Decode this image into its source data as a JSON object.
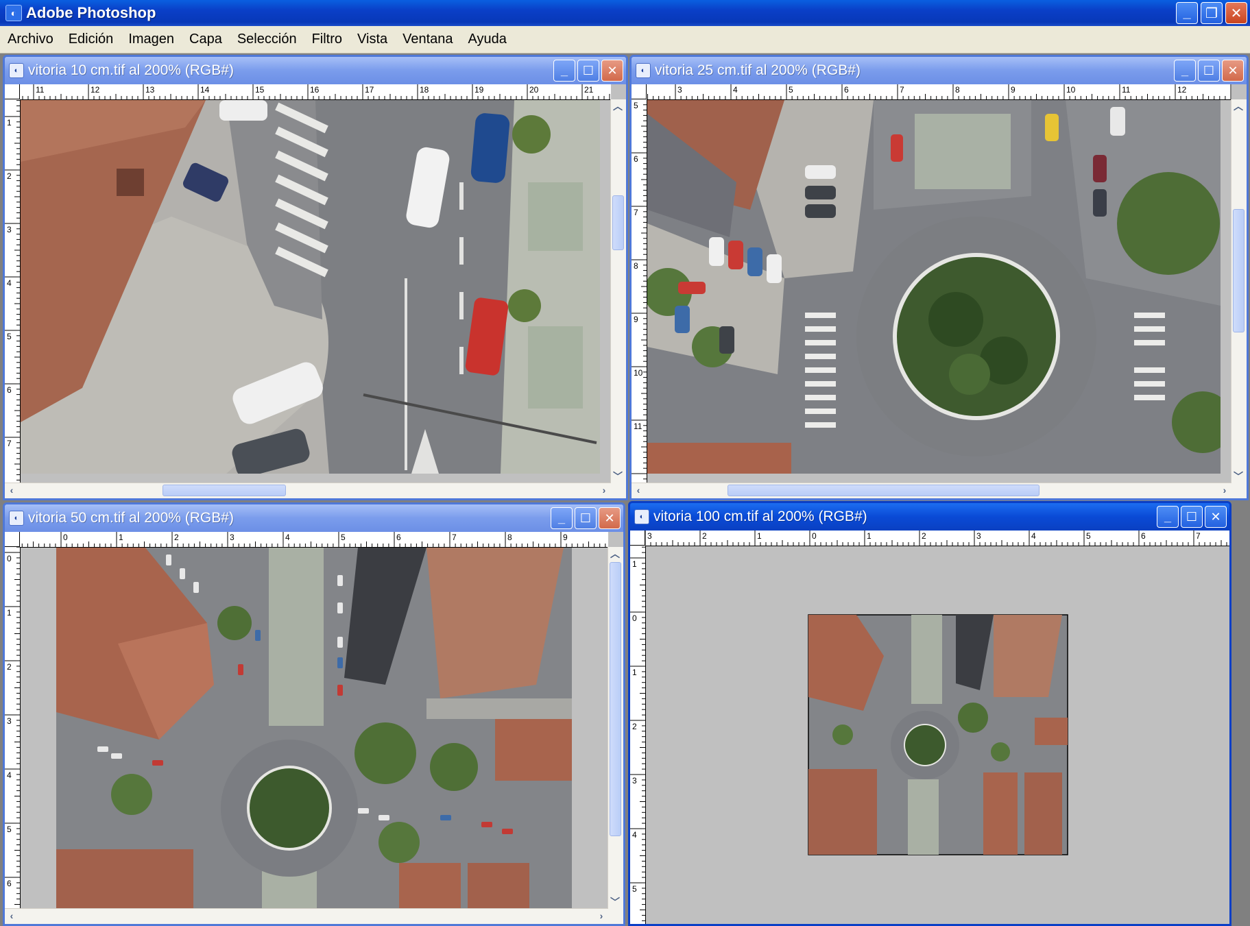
{
  "app": {
    "title": "Adobe Photoshop",
    "icon": "photoshop-app-icon",
    "controls": {
      "minimize": "_",
      "restore": "❐",
      "close": "✕"
    }
  },
  "menu": [
    "Archivo",
    "Edición",
    "Imagen",
    "Capa",
    "Selección",
    "Filtro",
    "Vista",
    "Ventana",
    "Ayuda"
  ],
  "documents": [
    {
      "title": "vitoria 10 cm.tif al 200% (RGB#)",
      "ruler_h": [
        "11",
        "12",
        "13",
        "14",
        "15",
        "16",
        "17",
        "18",
        "19",
        "20",
        "21"
      ],
      "ruler_v": [
        "1",
        "2",
        "3",
        "4",
        "5",
        "6",
        "7"
      ]
    },
    {
      "title": "vitoria 25 cm.tif al 200% (RGB#)",
      "ruler_h": [
        "3",
        "4",
        "5",
        "6",
        "7",
        "8",
        "9",
        "10",
        "11",
        "12"
      ],
      "ruler_v": [
        "5",
        "6",
        "7",
        "8",
        "9",
        "10",
        "11"
      ]
    },
    {
      "title": "vitoria 50 cm.tif al 200% (RGB#)",
      "ruler_h": [
        "0",
        "1",
        "2",
        "3",
        "4",
        "5",
        "6",
        "7",
        "8",
        "9"
      ],
      "ruler_v": [
        "0",
        "1",
        "2",
        "3",
        "4",
        "5",
        "6"
      ]
    },
    {
      "title": "vitoria 100 cm.tif al 200% (RGB#)",
      "ruler_h": [
        "3",
        "2",
        "1",
        "0",
        "1",
        "2",
        "3",
        "4",
        "5",
        "6",
        "7"
      ],
      "ruler_v": [
        "1",
        "0",
        "1",
        "2",
        "3",
        "4",
        "5"
      ]
    }
  ],
  "colors": {
    "titlebar_active": "#0a3fc7",
    "titlebar_inactive": "#7a9cec",
    "close_button": "#c9451f",
    "canvas_gray": "#c0c0c0"
  }
}
